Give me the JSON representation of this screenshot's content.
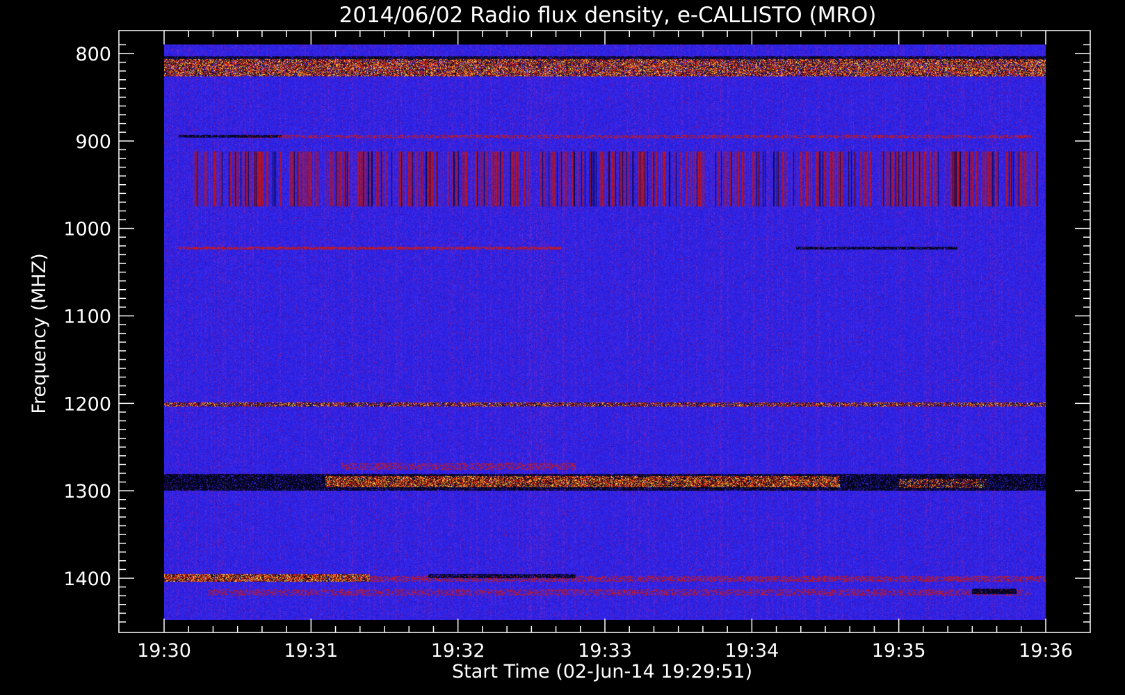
{
  "chart_data": {
    "type": "heatmap",
    "title": "2014/06/02  Radio flux density, e-CALLISTO (MRO)",
    "xlabel": "Start Time (02-Jun-14 19:29:51)",
    "ylabel": "Frequency (MHZ)",
    "x_ticks": [
      {
        "t": 0,
        "label": "19:30"
      },
      {
        "t": 1,
        "label": "19:31"
      },
      {
        "t": 2,
        "label": "19:32"
      },
      {
        "t": 3,
        "label": "19:33"
      },
      {
        "t": 4,
        "label": "19:34"
      },
      {
        "t": 5,
        "label": "19:35"
      },
      {
        "t": 6,
        "label": "19:36"
      }
    ],
    "y_ticks": [
      {
        "f": 800,
        "label": "800"
      },
      {
        "f": 900,
        "label": "900"
      },
      {
        "f": 1000,
        "label": "1000"
      },
      {
        "f": 1100,
        "label": "1100"
      },
      {
        "f": 1200,
        "label": "1200"
      },
      {
        "f": 1300,
        "label": "1300"
      },
      {
        "f": 1400,
        "label": "1400"
      }
    ],
    "x_range_minutes": [
      0,
      6
    ],
    "y_range_mhz": [
      1450,
      790
    ],
    "colors": {
      "background": "#2a1ee0",
      "low": "#000000",
      "mid": "#c01a10",
      "high": "#ffe040"
    },
    "bands": [
      {
        "f0": 803,
        "f1": 808,
        "t0": 0,
        "t1": 6,
        "kind": "dark",
        "strength": 0.8
      },
      {
        "f0": 806,
        "f1": 826,
        "t0": 0,
        "t1": 6,
        "kind": "hot",
        "strength": 0.85
      },
      {
        "f0": 893,
        "f1": 897,
        "t0": 0.5,
        "t1": 5.9,
        "kind": "warm",
        "strength": 0.45
      },
      {
        "f0": 893,
        "f1": 896,
        "t0": 0.1,
        "t1": 0.8,
        "kind": "dark",
        "strength": 0.8
      },
      {
        "f0": 912,
        "f1": 975,
        "t0": 0.2,
        "t1": 5.95,
        "kind": "stripes",
        "strength": 0.6
      },
      {
        "f0": 1021,
        "f1": 1024,
        "t0": 0.1,
        "t1": 2.7,
        "kind": "warm",
        "strength": 0.7
      },
      {
        "f0": 1021,
        "f1": 1024,
        "t0": 4.3,
        "t1": 5.4,
        "kind": "dark",
        "strength": 0.8
      },
      {
        "f0": 1199,
        "f1": 1204,
        "t0": 0,
        "t1": 6,
        "kind": "speckle",
        "strength": 0.8
      },
      {
        "f0": 1268,
        "f1": 1276,
        "t0": 1.2,
        "t1": 2.8,
        "kind": "warm",
        "strength": 0.35
      },
      {
        "f0": 1281,
        "f1": 1300,
        "t0": 0,
        "t1": 6,
        "kind": "dark",
        "strength": 0.85
      },
      {
        "f0": 1283,
        "f1": 1296,
        "t0": 1.1,
        "t1": 4.6,
        "kind": "hot",
        "strength": 0.9
      },
      {
        "f0": 1286,
        "f1": 1297,
        "t0": 5.0,
        "t1": 5.6,
        "kind": "hot",
        "strength": 0.55
      },
      {
        "f0": 1395,
        "f1": 1404,
        "t0": 0,
        "t1": 1.4,
        "kind": "hot",
        "strength": 0.95
      },
      {
        "f0": 1398,
        "f1": 1404,
        "t0": 1.4,
        "t1": 6,
        "kind": "warm",
        "strength": 0.45
      },
      {
        "f0": 1395,
        "f1": 1400,
        "t0": 1.8,
        "t1": 2.8,
        "kind": "dark",
        "strength": 0.75
      },
      {
        "f0": 1413,
        "f1": 1420,
        "t0": 0.3,
        "t1": 5.9,
        "kind": "warm",
        "strength": 0.35
      },
      {
        "f0": 1412,
        "f1": 1418,
        "t0": 5.5,
        "t1": 5.8,
        "kind": "dark",
        "strength": 0.9
      }
    ]
  }
}
